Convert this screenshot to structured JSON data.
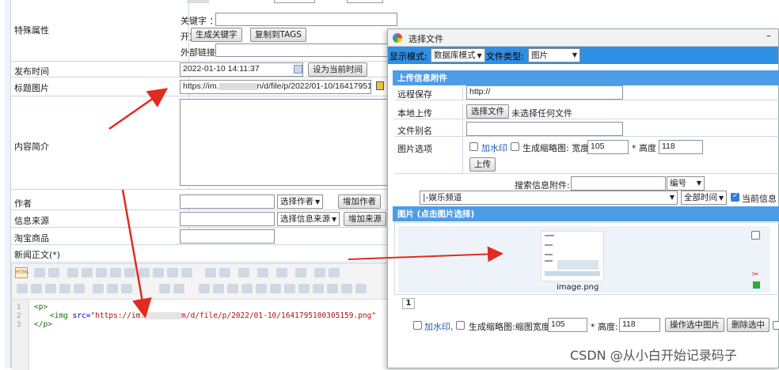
{
  "form": {
    "special_attr": {
      "label": "特殊属性",
      "keywords_label": "关键字 ：",
      "open_label": "开)",
      "gen_keywords_button": "生成关键字",
      "copy_tags_button": "复制到TAGS",
      "external_link_label": "外部链接:"
    },
    "publish_time": {
      "label": "发布时间",
      "value": "2022-01-10 14:11:37",
      "set_current_button": "设为当前时间"
    },
    "title_image": {
      "label": "标题图片",
      "value_prefix": "https://im.",
      "value_suffix": "n/d/file/p/2022/01-10/16417951"
    },
    "summary": {
      "label": "内容简介"
    },
    "author": {
      "label": "作者",
      "select": "选择作者",
      "add_button": "增加作者"
    },
    "source": {
      "label": "信息来源",
      "select": "选择信息来源",
      "add_button": "增加来源"
    },
    "taobao": {
      "label": "淘宝商品"
    },
    "body": {
      "label": "新闻正文(*)"
    }
  },
  "editor": {
    "toolbar_first_icon": "HTML",
    "code_lines": {
      "line1": "<p>",
      "line2_tag": "<img",
      "line2_attr": "src=",
      "line2_val_prefix": "\"https://im.",
      "line2_val_suffix": "m/d/file/p/2022/01-10/1641795100305159.png\"",
      "line3": "</p>"
    },
    "line_numbers": [
      "1",
      "2",
      "3"
    ]
  },
  "dialog": {
    "title": "选择文件",
    "display_mode_label": "显示模式:",
    "display_mode_value": "数据库模式",
    "file_type_label": "文件类型:",
    "file_type_value": "图片",
    "upload_section": "上传信息附件",
    "remote_save_label": "远程保存",
    "remote_save_value": "http://",
    "local_upload_label": "本地上传",
    "choose_file_button": "选择文件",
    "no_file_text": "未选择任何文件",
    "alias_label": "文件别名",
    "image_options_label": "图片选项",
    "watermark_label": "加水印",
    "thumbnail_label": "生成缩略图: 宽度",
    "width_value": "105",
    "height_label": "* 高度",
    "height_value": "118",
    "upload_button": "上传",
    "search_label": "搜索信息附件:",
    "search_field_select": "编号",
    "channel_select": "|-娱乐频道",
    "time_select": "全部时间",
    "current_info_label": "当前信息",
    "image_section": "图片 (点击图片选择)",
    "image_filename": "image.png",
    "page_number": "1",
    "bottom_watermark": "加水印,",
    "bottom_thumb_label": "生成缩略图:缩图宽度:",
    "bottom_width": "105",
    "bottom_height_label": "* 高度:",
    "bottom_height": "118",
    "operate_button": "操作选中图片",
    "delete_button": "删除选中"
  },
  "watermark": "CSDN @从小白开始记录码子",
  "colors": {
    "dialog_bar": "#2f8fe5",
    "section_header": "#4d9ce8",
    "arrow": "#e02b20"
  }
}
